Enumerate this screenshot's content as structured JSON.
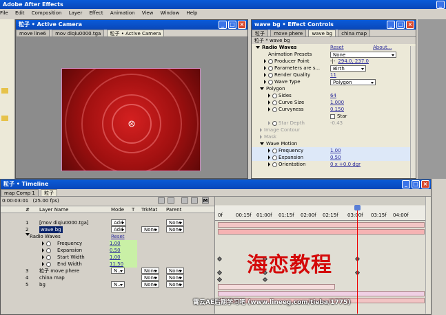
{
  "app": {
    "title": "Adobe After Effects"
  },
  "menu": [
    "File",
    "Edit",
    "Composition",
    "Layer",
    "Effect",
    "Animation",
    "View",
    "Window",
    "Help"
  ],
  "comp_window": {
    "title": "粒子 • Active Camera",
    "tabs": [
      "move line6",
      "mov diqiu0000.tga",
      "粒子 • Active Camera"
    ]
  },
  "effect_controls": {
    "title": "wave bg • Effect Controls",
    "tabs": [
      "粒子",
      "move phere",
      "wave bg",
      "china map"
    ],
    "header": "粒子 * wave bg",
    "rows": [
      {
        "label": "Radio Waves",
        "value": "Reset",
        "extra": "About..."
      },
      {
        "label": "Animation Presets",
        "value": "None"
      },
      {
        "label": "Producer Point",
        "value": "294.0, 237.0"
      },
      {
        "label": "Parameters are s...",
        "value": "Birth"
      },
      {
        "label": "Render Quality",
        "value": "11"
      },
      {
        "label": "Wave Type",
        "value": "Polygon"
      },
      {
        "label": "Polygon",
        "value": ""
      },
      {
        "label": "Sides",
        "value": "64"
      },
      {
        "label": "Curve Size",
        "value": "1.000"
      },
      {
        "label": "Curvyness",
        "value": "0.150"
      },
      {
        "label": "",
        "value": "Star"
      },
      {
        "label": "Star Depth",
        "value": "-0.43"
      },
      {
        "label": "Image Contour",
        "value": ""
      },
      {
        "label": "Mask",
        "value": ""
      },
      {
        "label": "Wave Motion",
        "value": ""
      },
      {
        "label": "Frequency",
        "value": "1.00"
      },
      {
        "label": "Expansion",
        "value": "0.50"
      },
      {
        "label": "Orientation",
        "value": "0 x +0.0 dgr"
      }
    ]
  },
  "timeline": {
    "title": "粒子 • Timeline",
    "tabs": [
      "map Comp 1",
      "粒子"
    ],
    "timecode": "0:00:03:01",
    "fps": "(25.00 fps)",
    "columns": [
      "#",
      "Layer Name",
      "Mode",
      "T",
      "TrkMat",
      "Parent"
    ],
    "ruler": [
      "0f",
      "00:15f",
      "01:00f",
      "01:15f",
      "02:00f",
      "02:15f",
      "03:00f",
      "03:15f",
      "04:00f"
    ],
    "layers": [
      {
        "num": "1",
        "name": "[mov diqiu0000.tga]",
        "mode": "Add",
        "trk": "",
        "parent": "None"
      },
      {
        "num": "2",
        "name": "wave bg",
        "mode": "Add",
        "trk": "None",
        "parent": "None"
      },
      {
        "num": "",
        "name": "Radio Waves",
        "mode": "Reset",
        "trk": "",
        "parent": ""
      },
      {
        "num": "",
        "name": "Frequency",
        "mode": "1.00",
        "trk": "",
        "parent": ""
      },
      {
        "num": "",
        "name": "Expansion",
        "mode": "0.50",
        "trk": "",
        "parent": ""
      },
      {
        "num": "",
        "name": "Start Width",
        "mode": "1.00",
        "trk": "",
        "parent": ""
      },
      {
        "num": "",
        "name": "End Width",
        "mode": "11.50",
        "trk": "",
        "parent": ""
      },
      {
        "num": "3",
        "name": "粒子 move phere",
        "mode": "N...",
        "trk": "None",
        "parent": "None"
      },
      {
        "num": "4",
        "name": "china map",
        "mode": "",
        "trk": "None",
        "parent": "None"
      },
      {
        "num": "5",
        "name": "bg",
        "mode": "N...",
        "trk": "None",
        "parent": "None"
      }
    ]
  },
  "overlay": {
    "title_cn": "海恋教程",
    "watermark": "霄云AE后期学习吧 (www.lineeg.com/tieba/1775)"
  },
  "colors": {
    "titlebar": "#0a5bd8",
    "accent_red": "#c81818",
    "keyframe_green": "#c9f0a6"
  }
}
